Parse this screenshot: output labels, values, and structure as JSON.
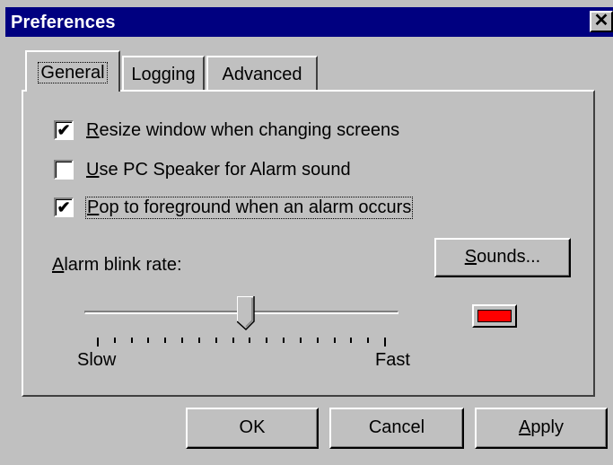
{
  "window": {
    "title": "Preferences",
    "close_label": "✕",
    "colors": {
      "titlebar": "#000080",
      "face": "#c0c0c0",
      "swatch": "#ff0000"
    }
  },
  "tabs": [
    {
      "label": "General",
      "selected": true
    },
    {
      "label": "Logging",
      "selected": false
    },
    {
      "label": "Advanced",
      "selected": false
    }
  ],
  "options": [
    {
      "label_first": "R",
      "label_rest": "esize window when changing screens",
      "checked": true
    },
    {
      "label_first": "U",
      "label_rest": "se PC Speaker for Alarm sound",
      "checked": false
    },
    {
      "label_first": "P",
      "label_rest": "op to foreground when an alarm occurs",
      "checked": true
    }
  ],
  "blink": {
    "label_first": "A",
    "label_rest": "larm blink rate:",
    "slow_label": "Slow",
    "fast_label": "Fast",
    "value_fraction": 0.52,
    "tick_count": 18
  },
  "sounds_button": {
    "label_first": "S",
    "label_rest": "ounds..."
  },
  "buttons": {
    "ok": "OK",
    "cancel": "Cancel",
    "apply_first": "A",
    "apply_rest": "pply"
  },
  "check_mark": "✔"
}
